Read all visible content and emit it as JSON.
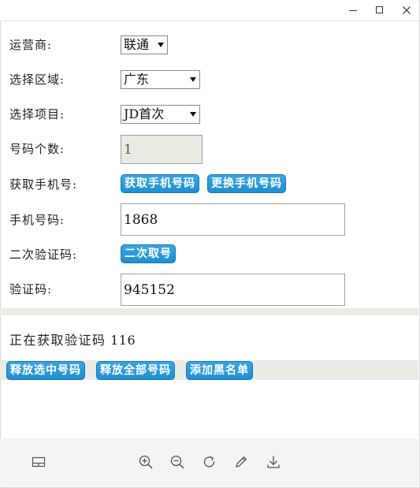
{
  "window": {
    "controls": [
      "minimize",
      "maximize",
      "close"
    ]
  },
  "form": {
    "carrier": {
      "label": "运营商:",
      "value": "联通"
    },
    "region": {
      "label": "选择区域:",
      "value": "广东"
    },
    "project": {
      "label": "选择项目:",
      "value": "JD首次"
    },
    "count": {
      "label": "号码个数:",
      "value": "1"
    },
    "get_phone": {
      "label": "获取手机号:",
      "get_button": "获取手机号码",
      "change_button": "更换手机号码"
    },
    "phone": {
      "label": "手机号码:",
      "value": "1868"
    },
    "second": {
      "label": "二次验证码:",
      "button": "二次取号"
    },
    "code": {
      "label": "验证码:",
      "value": "945152"
    }
  },
  "status": {
    "text": "正在获取验证码",
    "count": "116"
  },
  "actions": {
    "release_selected": "释放选中号码",
    "release_all": "释放全部号码",
    "add_blacklist": "添加黑名单"
  },
  "footer_icons": [
    "layout-icon",
    "zoom-in-icon",
    "zoom-out-icon",
    "rotate-icon",
    "edit-icon",
    "download-icon"
  ]
}
